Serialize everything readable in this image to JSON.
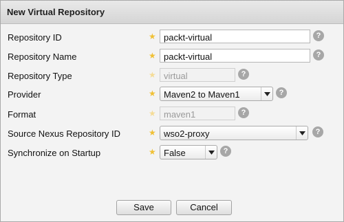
{
  "dialog": {
    "title": "New Virtual Repository"
  },
  "fields": [
    {
      "label": "Repository ID",
      "value": "packt-virtual",
      "help": "?"
    },
    {
      "label": "Repository Name",
      "value": "packt-virtual",
      "help": "?"
    },
    {
      "label": "Repository Type",
      "value": "virtual",
      "help": "?"
    },
    {
      "label": "Provider",
      "value": "Maven2 to Maven1",
      "help": "?"
    },
    {
      "label": "Format",
      "value": "maven1",
      "help": "?"
    },
    {
      "label": "Source Nexus Repository ID",
      "value": "wso2-proxy",
      "help": "?"
    },
    {
      "label": "Synchronize on Startup",
      "value": "False",
      "help": "?"
    }
  ],
  "required_marker": "★",
  "buttons": {
    "save": "Save",
    "cancel": "Cancel"
  },
  "colors": {
    "required_star": "#f0c034",
    "help_icon": "#a7a7a7",
    "titlebar": "#dcdcdc"
  }
}
